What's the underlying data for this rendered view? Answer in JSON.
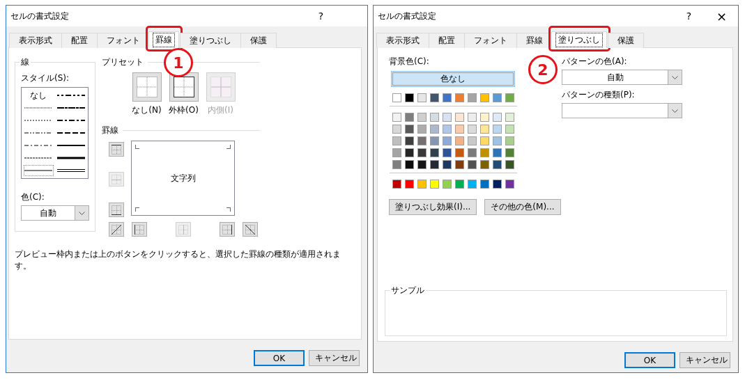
{
  "dialogs": [
    {
      "kind": "border",
      "title": "セルの書式設定",
      "title_buttons": [
        {
          "kind": "help",
          "label": "?"
        }
      ],
      "callout": "1",
      "tabs": [
        {
          "label": "表示形式",
          "selected": false,
          "highlighted": false
        },
        {
          "label": "配置",
          "selected": false,
          "highlighted": false
        },
        {
          "label": "フォント",
          "selected": false,
          "highlighted": false
        },
        {
          "label": "罫線",
          "selected": true,
          "highlighted": true
        },
        {
          "label": "塗りつぶし",
          "selected": false,
          "highlighted": false
        },
        {
          "label": "保護",
          "selected": false,
          "highlighted": false
        }
      ],
      "line_group": {
        "title": "線",
        "style_label": "スタイル(S):",
        "styles": [
          {
            "kind": "none",
            "label": "なし",
            "selected": false
          },
          {
            "kind": "hair",
            "selected": false
          },
          {
            "kind": "dotted",
            "selected": false
          },
          {
            "kind": "dash-dot-dot",
            "selected": false
          },
          {
            "kind": "dash-dot",
            "selected": false
          },
          {
            "kind": "dashed",
            "selected": false
          },
          {
            "kind": "thin",
            "selected": true
          },
          {
            "kind": "medium-dash-dot-dot",
            "selected": false
          },
          {
            "kind": "slant-dash-dot",
            "selected": false
          },
          {
            "kind": "medium-dash-dot",
            "selected": false
          },
          {
            "kind": "medium-dashed",
            "selected": false
          },
          {
            "kind": "medium",
            "selected": false
          },
          {
            "kind": "thick",
            "selected": false
          },
          {
            "kind": "double",
            "selected": false
          }
        ],
        "color_label": "色(C):",
        "color_value": "自動"
      },
      "preset_heading": "プリセット",
      "presets": [
        {
          "kind": "none",
          "label": "なし(N)",
          "disabled": false
        },
        {
          "kind": "outline",
          "label": "外枠(O)",
          "disabled": false
        },
        {
          "kind": "inside",
          "label": "内側(I)",
          "disabled": true
        }
      ],
      "border_heading": "罫線",
      "border_buttons": [
        {
          "kind": "top",
          "disabled": false
        },
        {
          "kind": "middle-horizontal",
          "disabled": true
        },
        {
          "kind": "bottom",
          "disabled": false
        },
        {
          "kind": "diagonal-up",
          "disabled": false
        },
        {
          "kind": "left",
          "disabled": false
        },
        {
          "kind": "middle-vertical",
          "disabled": true
        },
        {
          "kind": "right",
          "disabled": false
        },
        {
          "kind": "diagonal-down",
          "disabled": false
        }
      ],
      "preview_text": "文字列",
      "hint": "プレビュー枠内または上のボタンをクリックすると、選択した罫線の種類が適用されます。",
      "buttons": [
        {
          "label": "OK",
          "default": true
        },
        {
          "label": "キャンセル",
          "default": false
        }
      ]
    },
    {
      "kind": "fill",
      "title": "セルの書式設定",
      "title_buttons": [
        {
          "kind": "help",
          "label": "?"
        },
        {
          "kind": "close",
          "label": "×"
        }
      ],
      "callout": "2",
      "tabs": [
        {
          "label": "表示形式",
          "selected": false,
          "highlighted": false
        },
        {
          "label": "配置",
          "selected": false,
          "highlighted": false
        },
        {
          "label": "フォント",
          "selected": false,
          "highlighted": false
        },
        {
          "label": "罫線",
          "selected": false,
          "highlighted": false
        },
        {
          "label": "塗りつぶし",
          "selected": true,
          "highlighted": true
        },
        {
          "label": "保護",
          "selected": false,
          "highlighted": false
        }
      ],
      "fill": {
        "background_label": "背景色(C):",
        "no_color": {
          "label": "色なし",
          "selected": true
        },
        "theme_colors": [
          {
            "color": "#ffffff"
          },
          {
            "color": "#000000"
          },
          {
            "color": "#e7e6e6"
          },
          {
            "color": "#44546a"
          },
          {
            "color": "#4472c4"
          },
          {
            "color": "#ed7d31"
          },
          {
            "color": "#a5a5a5"
          },
          {
            "color": "#ffc000"
          },
          {
            "color": "#5b9bd5"
          },
          {
            "color": "#70ad47"
          }
        ],
        "tint_rows": [
          {
            "swatches": [
              {
                "color": "#f2f2f2"
              },
              {
                "color": "#7f7f7f"
              },
              {
                "color": "#d0cece"
              },
              {
                "color": "#d6dce4"
              },
              {
                "color": "#d9e2f3"
              },
              {
                "color": "#fbe5d5"
              },
              {
                "color": "#ededed"
              },
              {
                "color": "#fff2cc"
              },
              {
                "color": "#deebf6"
              },
              {
                "color": "#e2efd9"
              }
            ]
          },
          {
            "swatches": [
              {
                "color": "#d8d8d8"
              },
              {
                "color": "#595959"
              },
              {
                "color": "#aeabab"
              },
              {
                "color": "#adb9ca"
              },
              {
                "color": "#b4c6e7"
              },
              {
                "color": "#f7cbac"
              },
              {
                "color": "#dbdbdb"
              },
              {
                "color": "#fee599"
              },
              {
                "color": "#bdd7ee"
              },
              {
                "color": "#c5e0b3"
              }
            ]
          },
          {
            "swatches": [
              {
                "color": "#bfbfbf"
              },
              {
                "color": "#3f3f3f"
              },
              {
                "color": "#757070"
              },
              {
                "color": "#8496b0"
              },
              {
                "color": "#8eaadb"
              },
              {
                "color": "#f4b183"
              },
              {
                "color": "#c9c9c9"
              },
              {
                "color": "#ffd965"
              },
              {
                "color": "#9cc3e5"
              },
              {
                "color": "#a8d08d"
              }
            ]
          },
          {
            "swatches": [
              {
                "color": "#a5a5a5"
              },
              {
                "color": "#262626"
              },
              {
                "color": "#3a3838"
              },
              {
                "color": "#323f4f"
              },
              {
                "color": "#2f5496"
              },
              {
                "color": "#c55a11"
              },
              {
                "color": "#7b7b7b"
              },
              {
                "color": "#bf9000"
              },
              {
                "color": "#2e75b5"
              },
              {
                "color": "#538135"
              }
            ]
          },
          {
            "swatches": [
              {
                "color": "#7f7f7f"
              },
              {
                "color": "#0c0c0c"
              },
              {
                "color": "#171616"
              },
              {
                "color": "#222a35"
              },
              {
                "color": "#1e3864"
              },
              {
                "color": "#833c0b"
              },
              {
                "color": "#525252"
              },
              {
                "color": "#7f6000"
              },
              {
                "color": "#1f4e79"
              },
              {
                "color": "#375623"
              }
            ]
          }
        ],
        "standard_colors": [
          {
            "color": "#c00000"
          },
          {
            "color": "#ff0000"
          },
          {
            "color": "#ffc000"
          },
          {
            "color": "#ffff00"
          },
          {
            "color": "#92d050"
          },
          {
            "color": "#00b050"
          },
          {
            "color": "#00b0f0"
          },
          {
            "color": "#0070c0"
          },
          {
            "color": "#002060"
          },
          {
            "color": "#7030a0"
          }
        ],
        "effects_button": "塗りつぶし効果(I)...",
        "more_colors_button": "その他の色(M)...",
        "pattern_color_label": "パターンの色(A):",
        "pattern_color_value": "自動",
        "pattern_type_label": "パターンの種類(P):",
        "sample_label": "サンプル"
      },
      "buttons": [
        {
          "label": "OK",
          "default": true
        },
        {
          "label": "キャンセル",
          "default": false
        }
      ]
    }
  ]
}
